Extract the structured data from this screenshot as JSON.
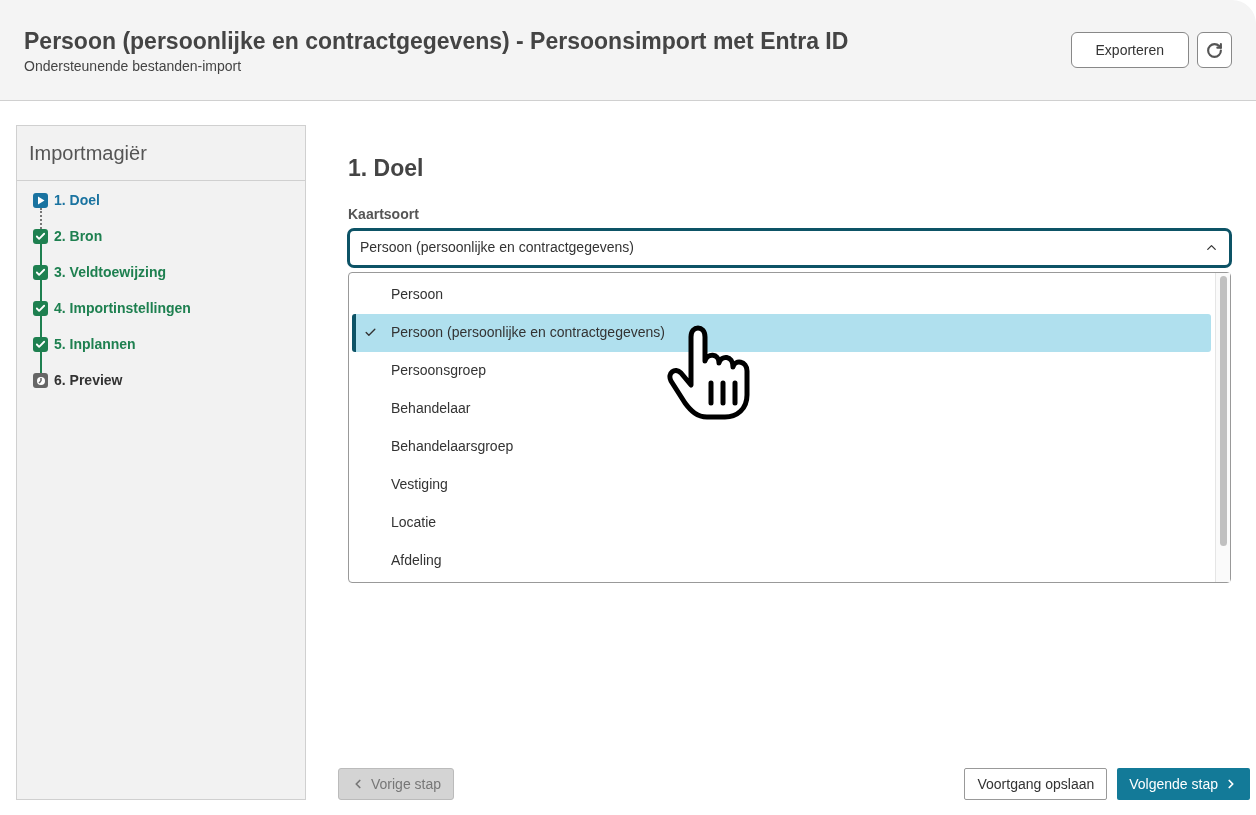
{
  "header": {
    "title": "Persoon (persoonlijke en contractgegevens) - Persoonsimport met Entra ID",
    "subtitle": "Ondersteunende bestanden-import",
    "export_button": "Exporteren"
  },
  "sidebar": {
    "title": "Importmagiër",
    "steps": [
      {
        "label": "1. Doel",
        "kind": "current"
      },
      {
        "label": "2. Bron",
        "kind": "done"
      },
      {
        "label": "3. Veldtoewijzing",
        "kind": "done"
      },
      {
        "label": "4. Importinstellingen",
        "kind": "done"
      },
      {
        "label": "5. Inplannen",
        "kind": "done"
      },
      {
        "label": "6. Preview",
        "kind": "pending"
      }
    ]
  },
  "main": {
    "heading": "1. Doel",
    "field_label": "Kaartsoort",
    "field_value": "Persoon (persoonlijke en contractgegevens)",
    "expanded": true,
    "options": [
      {
        "label": "Persoon",
        "selected": false
      },
      {
        "label": "Persoon (persoonlijke en contractgegevens)",
        "selected": true
      },
      {
        "label": "Persoonsgroep",
        "selected": false
      },
      {
        "label": "Behandelaar",
        "selected": false
      },
      {
        "label": "Behandelaarsgroep",
        "selected": false
      },
      {
        "label": "Vestiging",
        "selected": false
      },
      {
        "label": "Locatie",
        "selected": false
      },
      {
        "label": "Afdeling",
        "selected": false
      }
    ]
  },
  "footer": {
    "prev": {
      "label": "Vorige stap",
      "disabled": true
    },
    "save": "Voortgang opslaan",
    "next": {
      "label": "Volgende stap",
      "disabled": false
    }
  }
}
